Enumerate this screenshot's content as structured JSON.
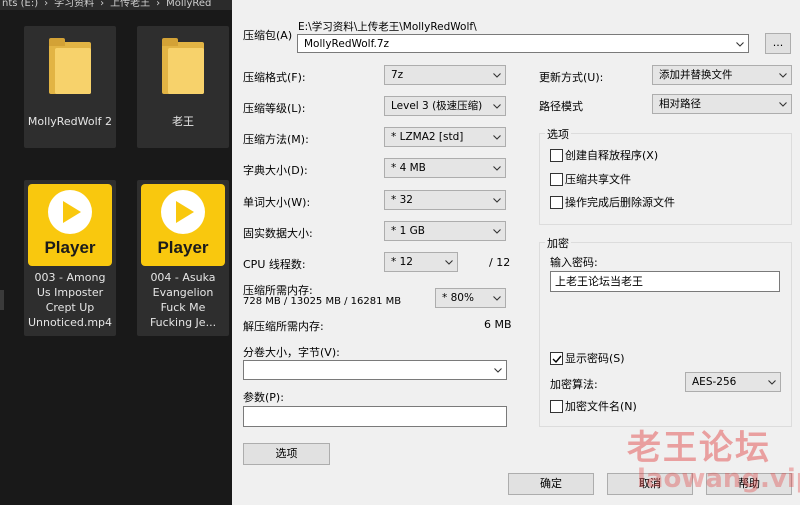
{
  "explorer": {
    "breadcrumb": [
      "nts (E:)",
      "›",
      "学习资料",
      "›",
      "上传老王",
      "›",
      "MollyRed"
    ],
    "items": [
      {
        "label": "MollyRedWolf 2",
        "type": "folder"
      },
      {
        "label": "老王",
        "type": "folder"
      },
      {
        "label": "003 - Among Us Imposter Crept Up Unnoticed.mp4",
        "type": "video",
        "icon_text": "Player"
      },
      {
        "label": "004 - Asuka Evangelion Fuck Me Fucking Je...",
        "type": "video",
        "icon_text": "Player"
      }
    ]
  },
  "dialog": {
    "archive_label": "压缩包(A)",
    "archive_path": "E:\\学习资料\\上传老王\\MollyRedWolf\\",
    "archive_name": "MollyRedWolf.7z",
    "browse_label": "...",
    "format_label": "压缩格式(F):",
    "format_value": "7z",
    "level_label": "压缩等级(L):",
    "level_value": "Level 3 (极速压缩)",
    "method_label": "压缩方法(M):",
    "method_value": "* LZMA2 [std]",
    "dict_label": "字典大小(D):",
    "dict_value": "* 4 MB",
    "word_label": "单词大小(W):",
    "word_value": "* 32",
    "solid_label": "固实数据大小:",
    "solid_value": "* 1 GB",
    "threads_label": "CPU 线程数:",
    "threads_value": "* 12",
    "threads_max": "/ 12",
    "mem_label": "压缩所需内存:",
    "mem_detail": "728 MB / 13025 MB / 16281 MB",
    "mem_percent": "* 80%",
    "decomp_label": "解压缩所需内存:",
    "decomp_value": "6 MB",
    "split_label": "分卷大小，字节(V):",
    "split_value": "",
    "params_label": "参数(P):",
    "params_value": "",
    "options_button": "选项",
    "update_label": "更新方式(U):",
    "update_value": "添加并替换文件",
    "path_label": "路径模式",
    "path_value": "相对路径",
    "options_group": "选项",
    "opt_sfx": "创建自释放程序(X)",
    "opt_shared": "压缩共享文件",
    "opt_delete": "操作完成后删除源文件",
    "encrypt_group": "加密",
    "password_label": "输入密码:",
    "password_value": "上老王论坛当老王",
    "show_password": "显示密码(S)",
    "enc_method_label": "加密算法:",
    "enc_method_value": "AES-256",
    "enc_names": "加密文件名(N)",
    "ok_button": "确定",
    "cancel_button": "取消",
    "help_button": "帮助"
  },
  "watermark": {
    "line1": "老王论坛",
    "line2": "laowang.vip"
  },
  "colors": {
    "player_yellow": "#f9c80e",
    "folder": "#f7d26b",
    "dialog_bg": "#f0f0f0"
  }
}
